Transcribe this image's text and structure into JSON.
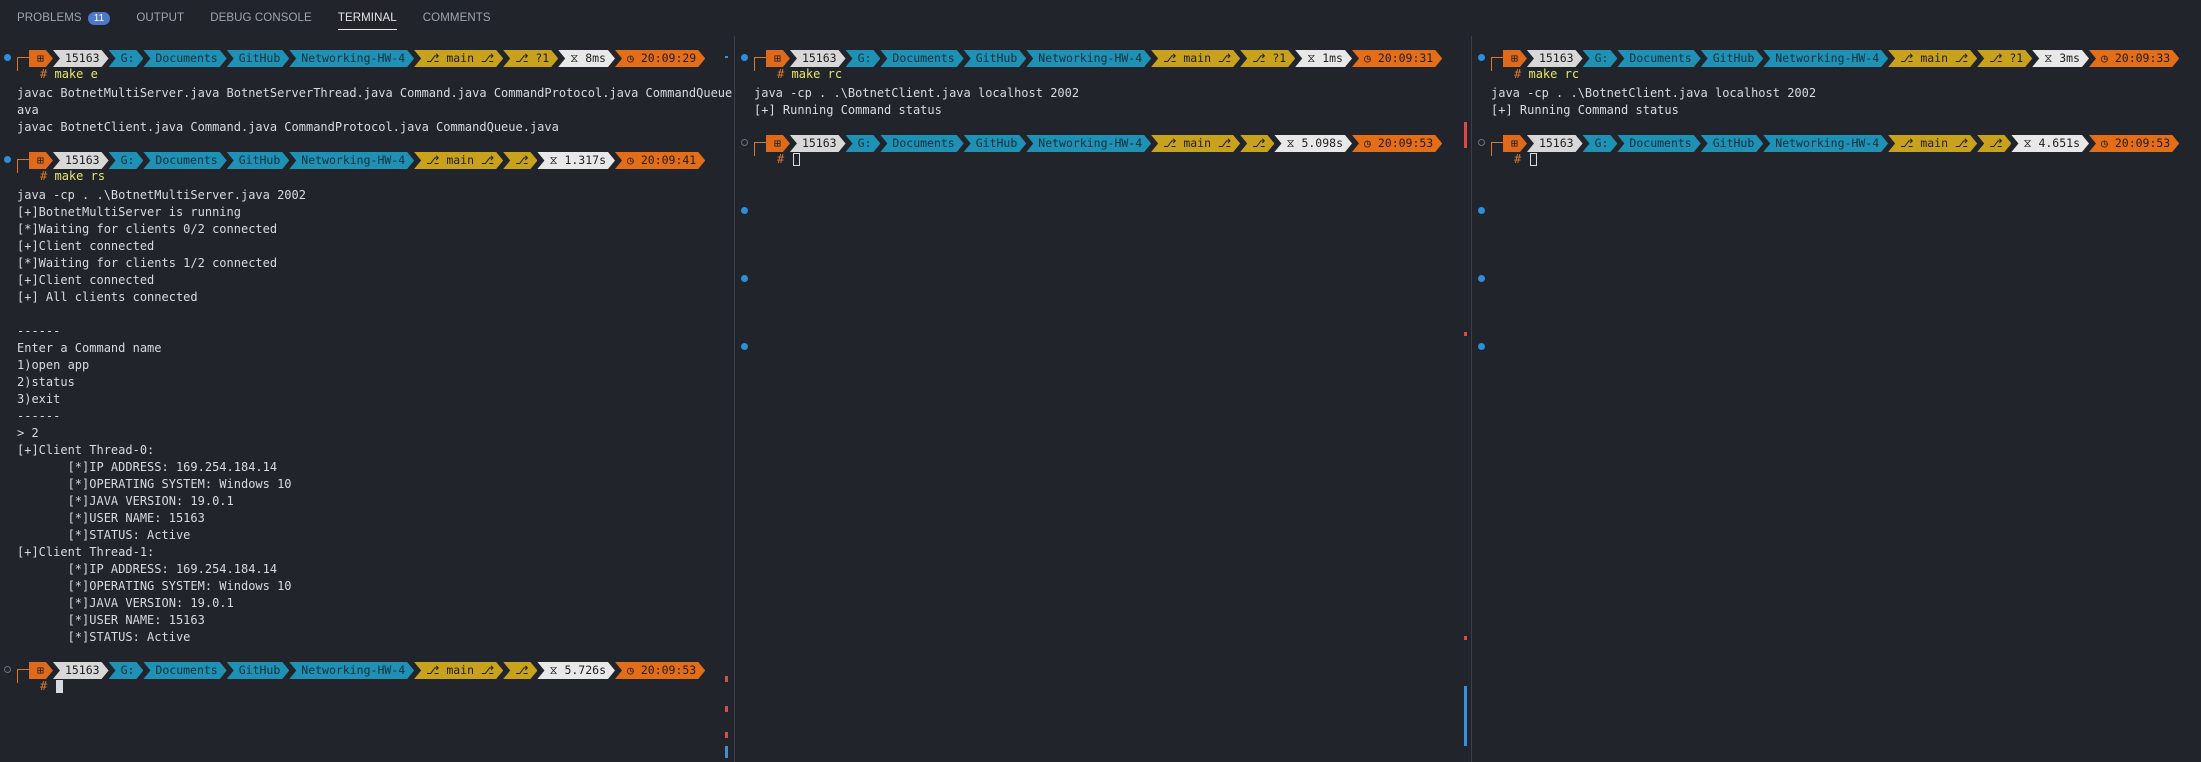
{
  "tabs": [
    {
      "label": "PROBLEMS",
      "badge": "11"
    },
    {
      "label": "OUTPUT"
    },
    {
      "label": "DEBUG CONSOLE"
    },
    {
      "label": "TERMINAL"
    },
    {
      "label": "COMMENTS"
    }
  ],
  "active_tab": "TERMINAL",
  "prompt_common": {
    "os_icon": "⊞",
    "user": "15163",
    "path": [
      "G:",
      "Documents",
      "GitHub",
      "Networking-HW-4"
    ],
    "branch": "⎇ main ⎇",
    "hash": "#"
  },
  "pane1": {
    "prompts": [
      {
        "status": "?1",
        "exec": "8ms",
        "time": "20:09:29",
        "command": "make e"
      },
      {
        "status": "",
        "exec": "1.317s",
        "time": "20:09:41",
        "command": "make rs"
      },
      {
        "status": "",
        "exec": "5.726s",
        "time": "20:09:53",
        "command": ""
      }
    ],
    "output1": [
      "javac BotnetMultiServer.java BotnetServerThread.java Command.java CommandProtocol.java CommandQueue.j",
      "ava",
      "javac BotnetClient.java Command.java CommandProtocol.java CommandQueue.java"
    ],
    "output2": [
      "java -cp . .\\BotnetMultiServer.java 2002",
      "[+]BotnetMultiServer is running",
      "[*]Waiting for clients 0/2 connected",
      "[+]Client connected",
      "[*]Waiting for clients 1/2 connected",
      "[+]Client connected",
      "[+] All clients connected",
      "",
      "------",
      "Enter a Command name",
      "1)open app",
      "2)status",
      "3)exit",
      "------",
      "> 2",
      "[+]Client Thread-0:",
      "       [*]IP ADDRESS: 169.254.184.14",
      "       [*]OPERATING SYSTEM: Windows 10",
      "       [*]JAVA VERSION: 19.0.1",
      "       [*]USER NAME: 15163",
      "       [*]STATUS: Active",
      "[+]Client Thread-1:",
      "       [*]IP ADDRESS: 169.254.184.14",
      "       [*]OPERATING SYSTEM: Windows 10",
      "       [*]JAVA VERSION: 19.0.1",
      "       [*]USER NAME: 15163",
      "       [*]STATUS: Active"
    ]
  },
  "pane2": {
    "prompts": [
      {
        "status": "?1",
        "exec": "1ms",
        "time": "20:09:31",
        "command": "make rc"
      },
      {
        "status": "",
        "exec": "5.098s",
        "time": "20:09:53",
        "command": ""
      }
    ],
    "output1": [
      "java -cp . .\\BotnetClient.java localhost 2002",
      "[+] Running Command status"
    ]
  },
  "pane3": {
    "prompts": [
      {
        "status": "?1",
        "exec": "3ms",
        "time": "20:09:33",
        "command": "make rc"
      },
      {
        "status": "",
        "exec": "4.651s",
        "time": "20:09:53",
        "command": ""
      }
    ],
    "output1": [
      "java -cp . .\\BotnetClient.java localhost 2002",
      "[+] Running Command status"
    ]
  },
  "colors": {
    "background": "#21252b",
    "os_segment": "#e06a1c",
    "path_segment": "#1f91b5",
    "git_segment": "#c8a11d",
    "time_segment": "#e46d17",
    "command_text": "#e5e56b"
  }
}
